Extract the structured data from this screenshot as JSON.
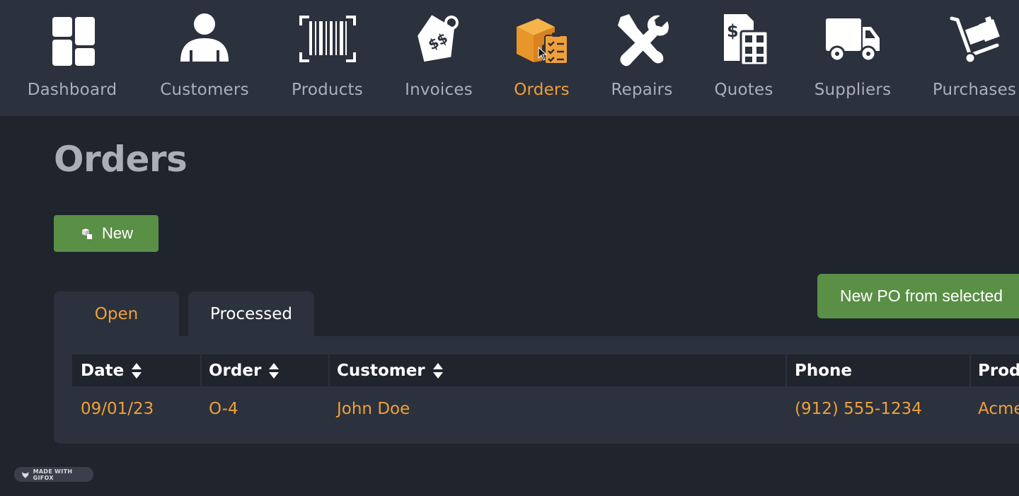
{
  "nav": {
    "items": [
      {
        "label": "Dashboard",
        "icon": "dashboard-icon"
      },
      {
        "label": "Customers",
        "icon": "customers-icon"
      },
      {
        "label": "Products",
        "icon": "barcode-icon"
      },
      {
        "label": "Invoices",
        "icon": "price-tag-icon"
      },
      {
        "label": "Orders",
        "icon": "orders-box-icon",
        "active": true
      },
      {
        "label": "Repairs",
        "icon": "tools-icon"
      },
      {
        "label": "Quotes",
        "icon": "calculator-icon"
      },
      {
        "label": "Suppliers",
        "icon": "truck-icon"
      },
      {
        "label": "Purchases",
        "icon": "hand-truck-icon"
      }
    ]
  },
  "page": {
    "title": "Orders",
    "new_button": "New",
    "new_po_button": "New PO from selected"
  },
  "tabs": [
    {
      "label": "Open",
      "active": true
    },
    {
      "label": "Processed",
      "active": false
    }
  ],
  "table": {
    "columns": [
      "Date",
      "Order",
      "Customer",
      "Phone",
      "Product"
    ],
    "rows": [
      {
        "date": "09/01/23",
        "order": "O-4",
        "customer": "John Doe",
        "phone": "(912) 555-1234",
        "product": "Acme"
      }
    ]
  },
  "watermark": "MADE WITH GIFOX",
  "colors": {
    "accent": "#f0a03a",
    "button_green": "#5a8f46",
    "nav_bg": "#2b313d",
    "page_bg": "#1f242d"
  }
}
